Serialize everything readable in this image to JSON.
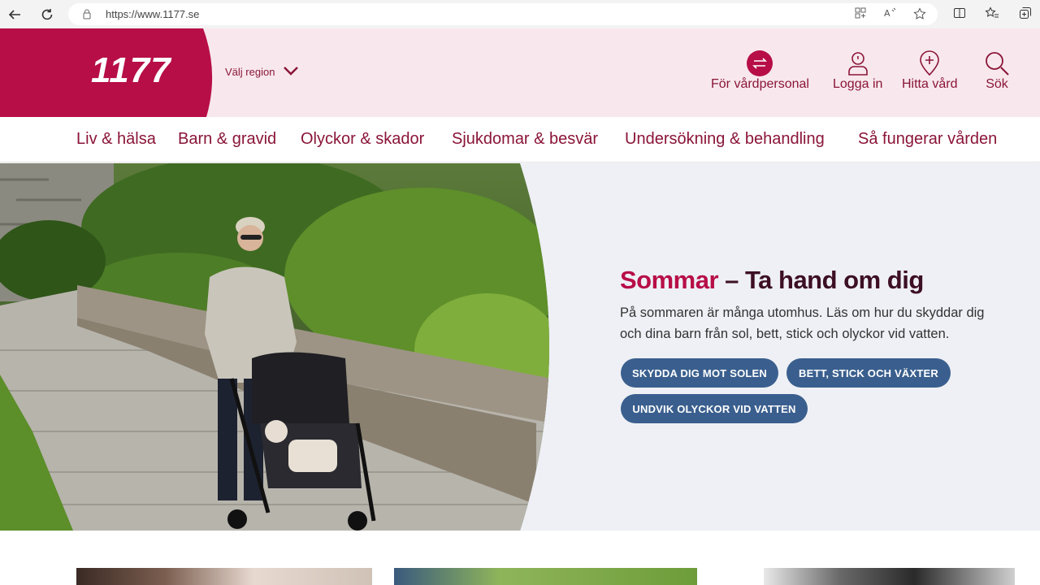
{
  "browser": {
    "url": "https://www.1177.se",
    "nav": {
      "back_icon": "back-arrow-icon",
      "refresh_icon": "refresh-icon"
    }
  },
  "header": {
    "logo": "1177",
    "region_label": "Välj region",
    "items": [
      {
        "label": "För vårdpersonal",
        "icon": "swap-arrows-icon"
      },
      {
        "label": "Logga in",
        "icon": "user-icon"
      },
      {
        "label": "Hitta vård",
        "icon": "location-pin-icon"
      },
      {
        "label": "Sök",
        "icon": "search-icon"
      }
    ]
  },
  "nav": {
    "items": [
      "Liv & hälsa",
      "Barn & gravid",
      "Olyckor & skador",
      "Sjukdomar & besvär",
      "Undersökning & behandling",
      "Så fungerar vården"
    ]
  },
  "hero": {
    "title_accent": "Sommar",
    "title_rest": " – Ta hand om dig",
    "text": "På sommaren är många utomhus. Läs om hur du skyddar dig och dina barn från sol, bett, stick och olyckor vid vatten.",
    "buttons": [
      "SKYDDA DIG MOT SOLEN",
      "BETT, STICK OCH VÄXTER",
      "UNDVIK OLYCKOR VID VATTEN"
    ]
  },
  "colors": {
    "brand": "#b70e47",
    "brand_dark": "#8a1538",
    "header_bg": "#f8e8ed",
    "button_bg": "#3a5f8e"
  }
}
